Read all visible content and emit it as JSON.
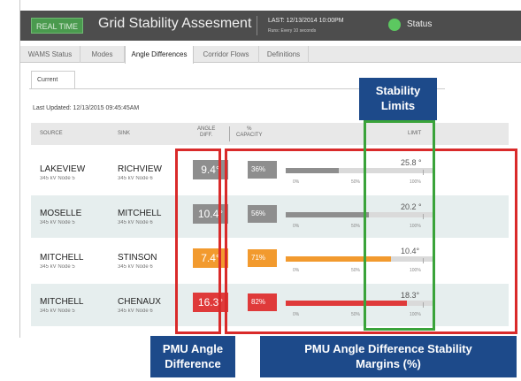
{
  "header": {
    "realtime_label": "REAL TIME",
    "title": "Grid Stability Assesment",
    "last_label": "LAST:",
    "last_value": "12/13/2014 10:00PM",
    "runs_label": "Runs:",
    "runs_value": "Every 10 seconds",
    "status_label": "Status",
    "status_color": "#5cc860"
  },
  "tabs": [
    {
      "label": "WAMS Status",
      "active": false
    },
    {
      "label": "Modes",
      "active": false
    },
    {
      "label": "Angle Differences",
      "active": true
    },
    {
      "label": "Corridor Flows",
      "active": false
    },
    {
      "label": "Definitions",
      "active": false
    }
  ],
  "subtab": {
    "label": "Current"
  },
  "last_updated": "Last Updated: 12/13/2015 09:45:45AM",
  "table": {
    "columns": {
      "source": "SOURCE",
      "sink": "SINK",
      "angle_diff_1": "ANGLE",
      "angle_diff_2": "DIFF.",
      "capacity_1": "%",
      "capacity_2": "CAPACITY",
      "limit": "LIMIT"
    },
    "axis": {
      "zero": "0%",
      "fifty": "50%",
      "hundred": "100%"
    },
    "rows": [
      {
        "source": "LAKEVIEW",
        "source_sub": "345 kV  Node 5",
        "sink": "RICHVIEW",
        "sink_sub": "345 kV  Node 6",
        "angle": "9.4°",
        "pct": "36%",
        "pct_value": 36,
        "limit": "25.8 °",
        "color": "#8e8e8e"
      },
      {
        "source": "MOSELLE",
        "source_sub": "345 kV  Node 5",
        "sink": "MITCHELL",
        "sink_sub": "345 kV  Node 6",
        "angle": "10.4°",
        "pct": "56%",
        "pct_value": 56,
        "limit": "20.2 °",
        "color": "#8e8e8e"
      },
      {
        "source": "MITCHELL",
        "source_sub": "345 kV  Node 5",
        "sink": "STINSON",
        "sink_sub": "345 kV  Node 6",
        "angle": "7.4°",
        "pct": "71%",
        "pct_value": 71,
        "limit": "10.4°",
        "color": "#f29a2e"
      },
      {
        "source": "MITCHELL",
        "source_sub": "345 kV  Node 5",
        "sink": "CHENAUX",
        "sink_sub": "345 kV  Node 6",
        "angle": "16.3°",
        "pct": "82%",
        "pct_value": 82,
        "limit": "18.3°",
        "color": "#df3a3a"
      }
    ]
  },
  "annotations": {
    "stability_1": "Stability",
    "stability_2": "Limits",
    "pmu_angle_1": "PMU Angle",
    "pmu_angle_2": "Difference",
    "margins_1": "PMU Angle Difference Stability",
    "margins_2": "Margins (%)"
  }
}
